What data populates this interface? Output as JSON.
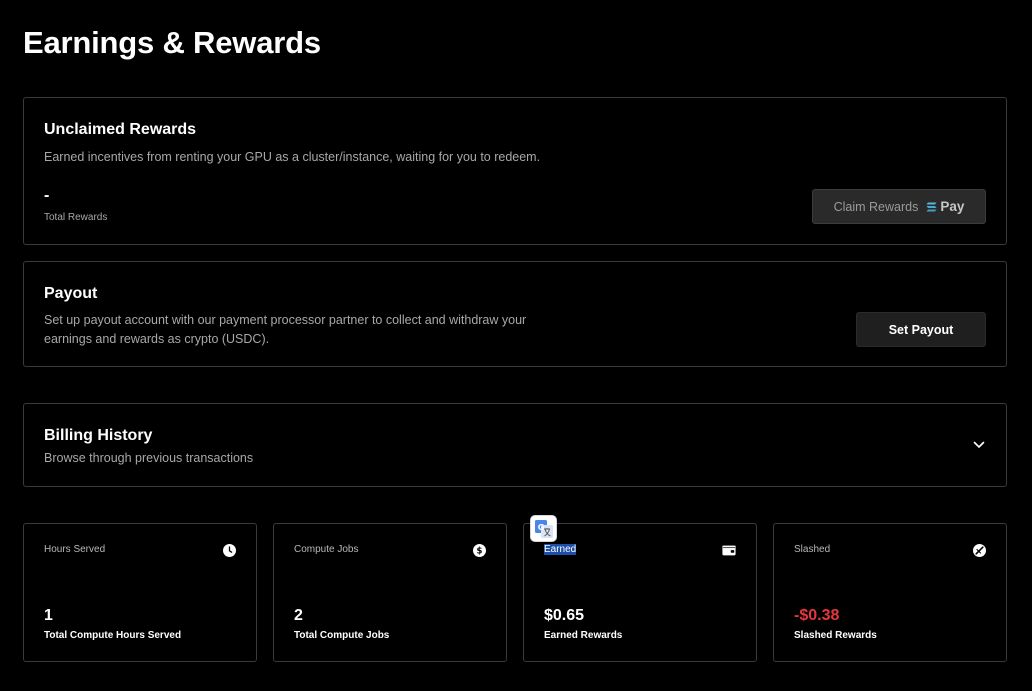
{
  "page": {
    "title": "Earnings & Rewards"
  },
  "unclaimed": {
    "title": "Unclaimed Rewards",
    "description": "Earned incentives from renting your GPU as a cluster/instance, waiting for you to redeem.",
    "value": "-",
    "value_label": "Total Rewards",
    "claim_label": "Claim Rewards",
    "pay_label": "Pay",
    "pay_icon": "solana-pay-icon"
  },
  "payout": {
    "title": "Payout",
    "description": "Set up payout account with our payment processor partner to collect and withdraw your earnings and rewards as crypto (USDC).",
    "button_label": "Set Payout"
  },
  "billing": {
    "title": "Billing History",
    "description": "Browse through previous transactions",
    "toggle_icon": "chevron-down-icon"
  },
  "stats": [
    {
      "label": "Hours Served",
      "icon": "clock-icon",
      "value": "1",
      "sublabel": "Total Compute Hours Served"
    },
    {
      "label": "Compute Jobs",
      "icon": "dollar-coin-icon",
      "value": "2",
      "sublabel": "Total Compute Jobs"
    },
    {
      "label": "Earned",
      "icon": "wallet-icon",
      "value": "$0.65",
      "sublabel": "Earned Rewards"
    },
    {
      "label": "Slashed",
      "icon": "slashed-circle-icon",
      "value": "-$0.38",
      "sublabel": "Slashed Rewards"
    }
  ],
  "colors": {
    "background": "#000000",
    "border": "#3a3a3a",
    "negative": "#e5373c",
    "selection": "#1d4ea8"
  }
}
